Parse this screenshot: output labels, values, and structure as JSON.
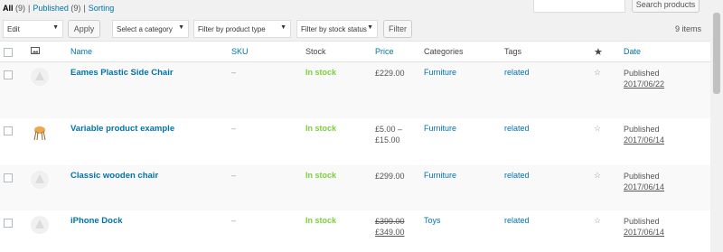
{
  "filters": {
    "all_label": "All",
    "all_count": "(9)",
    "published_label": "Published",
    "published_count": "(9)",
    "sorting_label": "Sorting",
    "separator": "|"
  },
  "search": {
    "button_label": "Search products",
    "placeholder": ""
  },
  "toolbar": {
    "bulk_action": "Edit",
    "apply_label": "Apply",
    "category_select": "Select a category",
    "product_type_select": "Filter by product type",
    "stock_status_select": "Filter by stock status",
    "filter_label": "Filter",
    "items_count": "9 items"
  },
  "table": {
    "headers": {
      "name": "Name",
      "sku": "SKU",
      "stock": "Stock",
      "price": "Price",
      "categories": "Categories",
      "tags": "Tags",
      "featured": "★",
      "date": "Date"
    },
    "rows": [
      {
        "name": "Eames Plastic Side Chair",
        "sku": "–",
        "stock": "In stock",
        "price": "£229.00",
        "price2": "",
        "category": "Furniture",
        "tag": "related",
        "status": "Published",
        "date": "2017/06/22",
        "thumb": "placeholder"
      },
      {
        "name": "Variable product example",
        "sku": "–",
        "stock": "In stock",
        "price": "£5.00 –",
        "price2": "£15.00",
        "category": "Furniture",
        "tag": "related",
        "status": "Published",
        "date": "2017/06/14",
        "thumb": "chair"
      },
      {
        "name": "Classic wooden chair",
        "sku": "–",
        "stock": "In stock",
        "price": "£299.00",
        "price2": "",
        "category": "Furniture",
        "tag": "related",
        "status": "Published",
        "date": "2017/06/14",
        "thumb": "placeholder"
      },
      {
        "name": "iPhone Dock",
        "sku": "–",
        "stock": "In stock",
        "price_old": "£399.00",
        "price": "£349.00",
        "category": "Toys",
        "tag": "related",
        "status": "Published",
        "date": "2017/06/14",
        "thumb": "placeholder"
      }
    ]
  },
  "icons": {
    "chevron": "chevron-down-icon",
    "image": "image-icon",
    "star": "star-outline-icon"
  }
}
